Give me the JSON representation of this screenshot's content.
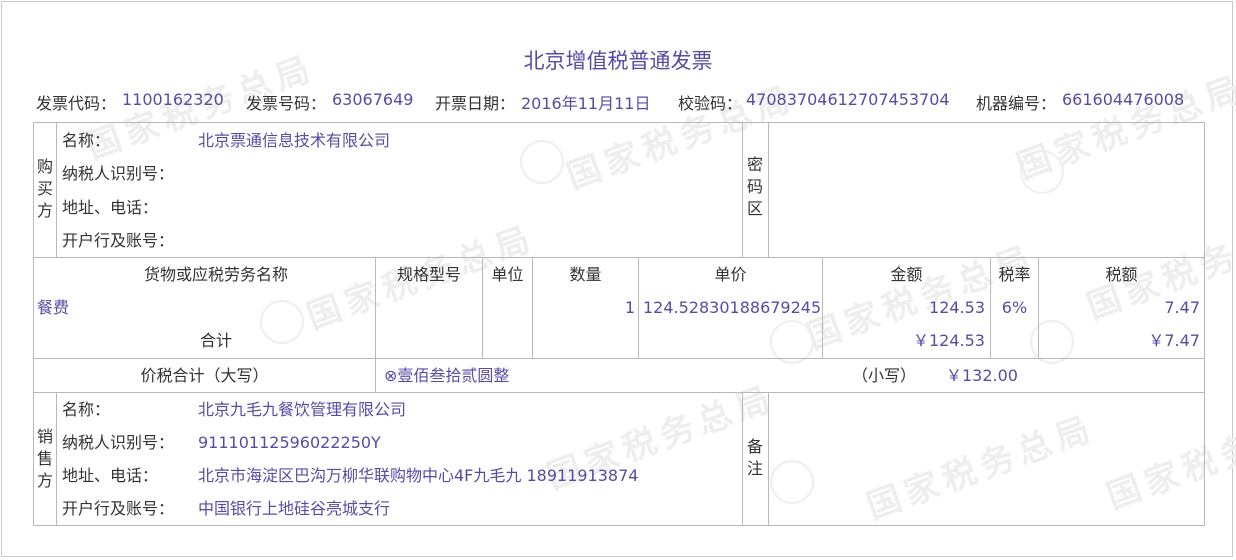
{
  "title": "北京增值税普通发票",
  "header": {
    "code_label": "发票代码：",
    "code": "1100162320",
    "number_label": "发票号码：",
    "number": "63067649",
    "date_label": "开票日期：",
    "date": "2016年11月11日",
    "check_label": "校验码：",
    "check": "47083704612707453704",
    "machine_label": "机器编号：",
    "machine": "661604476008"
  },
  "watermark": "国家税务总局",
  "buyer": {
    "side_label": "购买方",
    "name_label": "名称：",
    "name": "北京票通信息技术有限公司",
    "tax_id_label": "纳税人识别号：",
    "tax_id": "",
    "address_label": "地址、电话：",
    "address": "",
    "bank_label": "开户行及账号：",
    "bank": ""
  },
  "cipher_label": "密码区",
  "items_header": {
    "name": "货物或应税劳务名称",
    "spec": "规格型号",
    "unit": "单位",
    "qty": "数量",
    "price": "单价",
    "amount": "金额",
    "rate": "税率",
    "tax": "税额"
  },
  "items": [
    {
      "name": "餐费",
      "spec": "",
      "unit": "",
      "qty": "1",
      "price": "124.52830188679245",
      "amount": "124.53",
      "rate": "6%",
      "tax": "7.47"
    }
  ],
  "total_label": "合计",
  "total_amount": "￥124.53",
  "total_tax": "￥7.47",
  "grand": {
    "label": "价税合计（大写）",
    "upper": "⊗壹佰叁拾贰圆整",
    "lower_label": "（小写）",
    "lower": "￥132.00"
  },
  "seller": {
    "side_label": "销售方",
    "name_label": "名称：",
    "name": "北京九毛九餐饮管理有限公司",
    "tax_id_label": "纳税人识别号：",
    "tax_id": "91110112596022250Y",
    "address_label": "地址、电话：",
    "address": "北京市海淀区巴沟万柳华联购物中心4F九毛九 18911913874",
    "bank_label": "开户行及账号：",
    "bank": "中国银行上地硅谷亮城支行"
  },
  "remark_label": "备注",
  "colors": {
    "value": "#5a4aa6",
    "label": "#333333",
    "border": "#b8b8b8"
  }
}
